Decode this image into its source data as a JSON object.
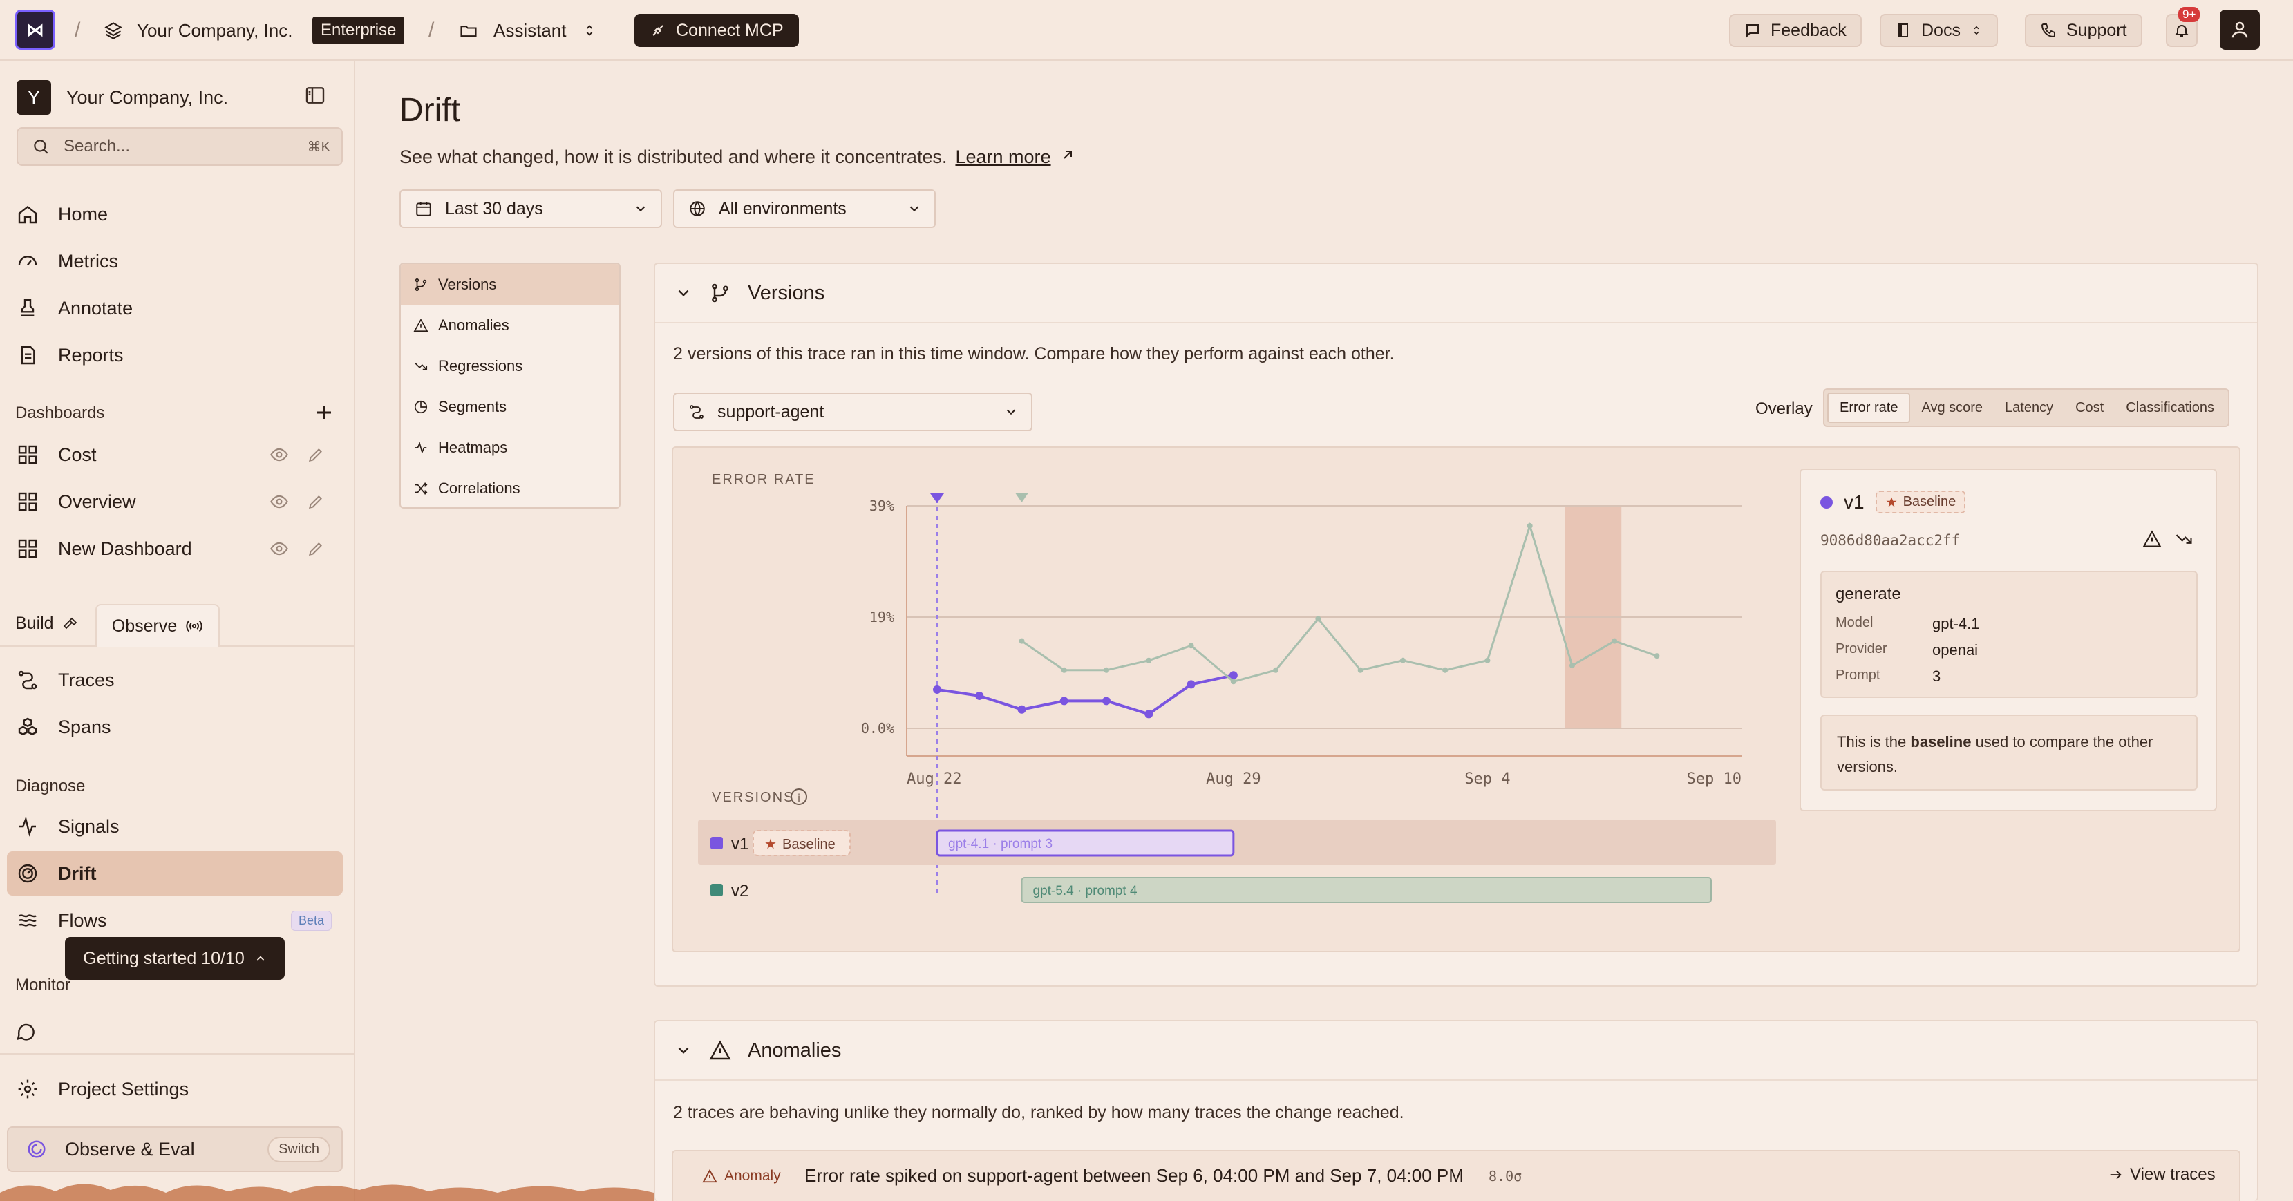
{
  "topbar": {
    "logo": "⋈",
    "company": "Your Company, Inc.",
    "plan_badge": "Enterprise",
    "project": "Assistant",
    "connect_mcp": "Connect MCP",
    "feedback": "Feedback",
    "docs": "Docs",
    "support": "Support",
    "notifications_count": "9+"
  },
  "sidebar": {
    "company_initial": "Y",
    "company": "Your Company, Inc.",
    "search_placeholder": "Search...",
    "search_shortcut": "⌘K",
    "primary": [
      {
        "label": "Home",
        "icon": "home-icon"
      },
      {
        "label": "Metrics",
        "icon": "gauge-icon"
      },
      {
        "label": "Annotate",
        "icon": "stamp-icon"
      },
      {
        "label": "Reports",
        "icon": "document-icon"
      }
    ],
    "dashboards_label": "Dashboards",
    "dashboards": [
      {
        "label": "Cost"
      },
      {
        "label": "Overview"
      },
      {
        "label": "New Dashboard"
      }
    ],
    "tab_build": "Build",
    "tab_observe": "Observe",
    "observe_items": [
      {
        "label": "Traces"
      },
      {
        "label": "Spans"
      }
    ],
    "diagnose_label": "Diagnose",
    "diagnose_items": [
      {
        "label": "Signals"
      },
      {
        "label": "Drift",
        "active": true
      },
      {
        "label": "Flows",
        "badge": "Beta"
      }
    ],
    "monitor_label": "Monitor",
    "getting_started": "Getting started 10/10",
    "project_settings": "Project Settings",
    "workspace": "Observe & Eval",
    "switch": "Switch"
  },
  "page": {
    "title": "Drift",
    "subtitle": "See what changed, how it is distributed and where it concentrates.",
    "learn_more": "Learn more",
    "date_range": "Last 30 days",
    "environment": "All environments"
  },
  "subnav": [
    {
      "label": "Versions",
      "active": true
    },
    {
      "label": "Anomalies"
    },
    {
      "label": "Regressions"
    },
    {
      "label": "Segments"
    },
    {
      "label": "Heatmaps"
    },
    {
      "label": "Correlations"
    }
  ],
  "versions_card": {
    "title": "Versions",
    "description": "2 versions of this trace ran in this time window. Compare how they perform against each other.",
    "agent": "support-agent",
    "overlay_label": "Overlay",
    "overlay_options": [
      "Error rate",
      "Avg score",
      "Latency",
      "Cost",
      "Classifications"
    ],
    "overlay_selected": "Error rate"
  },
  "chart_data": {
    "type": "line",
    "title": "",
    "ylabel": "ERROR RATE",
    "y_ticks": [
      "39%",
      "19%",
      "0.0%"
    ],
    "x_ticks": [
      "Aug 22",
      "Aug 29",
      "Sep 4",
      "Sep 10"
    ],
    "ylim": [
      0,
      39
    ],
    "x": [
      "Aug 22",
      "Aug 23",
      "Aug 24",
      "Aug 25",
      "Aug 26",
      "Aug 27",
      "Aug 28",
      "Aug 29",
      "Aug 30",
      "Aug 31",
      "Sep 1",
      "Sep 2",
      "Sep 3",
      "Sep 4",
      "Sep 5",
      "Sep 6",
      "Sep 7",
      "Sep 8",
      "Sep 9",
      "Sep 10"
    ],
    "highlight_range": [
      "Sep 6",
      "Sep 7"
    ],
    "series": [
      {
        "name": "v1",
        "color": "#7a55e0",
        "values": [
          6.8,
          5.7,
          3.3,
          4.8,
          4.8,
          2.5,
          7.7,
          9.3,
          null,
          null,
          null,
          null,
          null,
          null,
          null,
          null,
          null,
          null,
          null,
          null
        ]
      },
      {
        "name": "v2",
        "color": "#a9bfae",
        "values": [
          null,
          null,
          15.3,
          10.2,
          10.2,
          11.9,
          14.5,
          8.2,
          10.2,
          19.2,
          10.2,
          11.9,
          10.2,
          11.9,
          35.5,
          11.0,
          15.3,
          12.7
        ]
      }
    ],
    "versions_label": "VERSIONS",
    "version_rows": [
      {
        "name": "v1",
        "badge": "Baseline",
        "bar_label": "gpt-4.1 · prompt 3",
        "color": "#7a55e0",
        "start": "Aug 22",
        "end": "Aug 29"
      },
      {
        "name": "v2",
        "badge": "",
        "bar_label": "gpt-5.4 · prompt 4",
        "color": "#3f8a78",
        "start": "Aug 24",
        "end": "Sep 10"
      }
    ]
  },
  "version_info": {
    "name": "v1",
    "badge": "Baseline",
    "hash": "9086d80aa2acc2ff",
    "step": "generate",
    "model_label": "Model",
    "model": "gpt-4.1",
    "provider_label": "Provider",
    "provider": "openai",
    "prompt_label": "Prompt",
    "prompt": "3",
    "note_prefix": "This is the",
    "note_bold": "baseline",
    "note_suffix": "used to compare the other versions."
  },
  "anomalies_card": {
    "title": "Anomalies",
    "description": "2 traces are behaving unlike they normally do, ranked by how many traces the change reached.",
    "row_badge": "Anomaly",
    "row_text": "Error rate spiked on support-agent between Sep 6, 04:00 PM and Sep 7, 04:00 PM",
    "row_sigma": "8.0σ",
    "view_traces": "View traces"
  },
  "colors": {
    "accent": "#7a55e0",
    "secondary_series": "#a9bfae",
    "background": "#f5e8df",
    "dark": "#2a1d17"
  }
}
